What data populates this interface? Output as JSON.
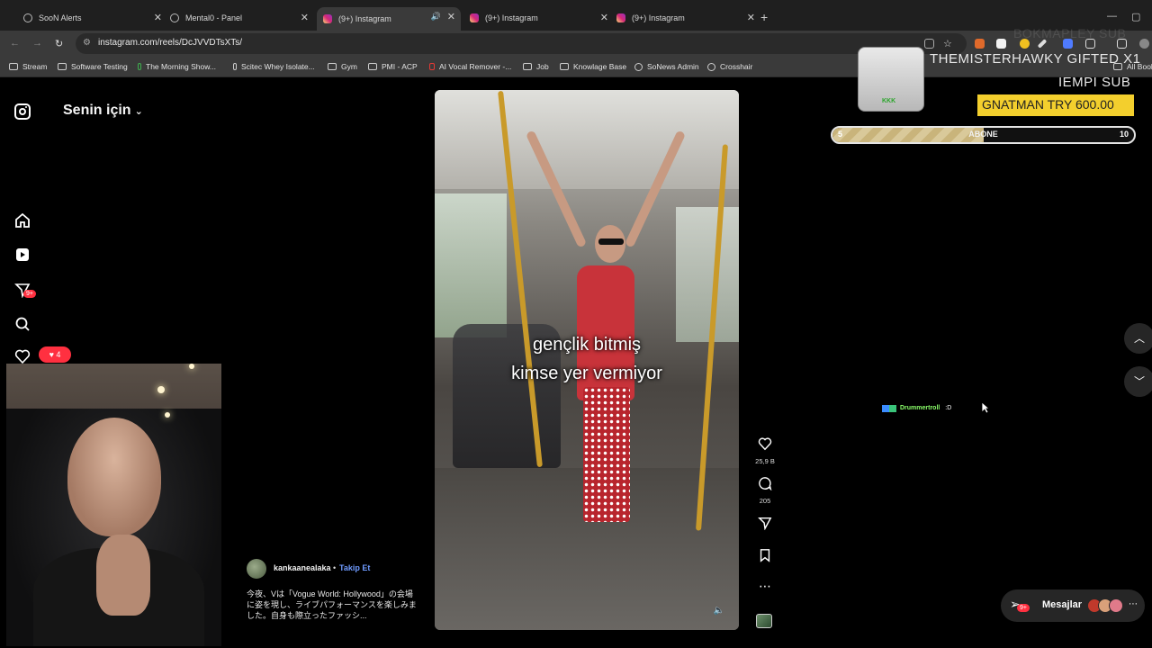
{
  "browser": {
    "tabs": [
      {
        "title": "SooN Alerts"
      },
      {
        "title": "Mental0 - Panel"
      },
      {
        "title": "(9+) Instagram"
      },
      {
        "title": "(9+) Instagram"
      },
      {
        "title": "(9+) Instagram"
      }
    ],
    "url": "instagram.com/reels/DcJVVDTsXTs/",
    "bookmarks": [
      "Stream",
      "Software Testing",
      "The Morning Show...",
      "Scitec Whey Isolate...",
      "Gym",
      "PMI - ACP",
      "AI Vocal Remover -...",
      "Job",
      "Knowlage Base",
      "SoNews Admin",
      "Crosshair",
      "All Bookmarks"
    ]
  },
  "instagram": {
    "feed_title": "Senin için",
    "notifications_badge": "9+",
    "likes_notification": "4",
    "reel": {
      "caption_line1": "gençlik bitmiş",
      "caption_line2": "kimse yer vermiyor",
      "likes": "25,9 B",
      "comments": "205"
    },
    "post": {
      "author": "kankaanealaka",
      "follow_label": "Takip Et",
      "separator": "•",
      "description": "今夜、Vは「Vogue World: Hollywood」の会場に姿を現し、ライブパフォーマンスを楽しみました。自身も際立ったファッシ..."
    },
    "messages": {
      "label": "Mesajlar",
      "badge": "9+"
    }
  },
  "stream_overlay": {
    "faded_top": "BOKMAPLEY SUB",
    "line1": "THEMISTERHAWKY GIFTED X1",
    "line2": "IEMPI SUB",
    "donation": "GNATMAN TRY 600.00",
    "gift_label": "KKK",
    "subgoal": {
      "label": "ABONE",
      "current": "5",
      "target": "10",
      "progress": 0.5
    },
    "chat": {
      "name": "Drummertroll",
      "message": ":D"
    }
  },
  "colors": {
    "accent_blue": "#6f9bff",
    "notification_red": "#ff3040",
    "donation_yellow": "#f3cf2d",
    "chat_name_green": "#8bff6a"
  }
}
